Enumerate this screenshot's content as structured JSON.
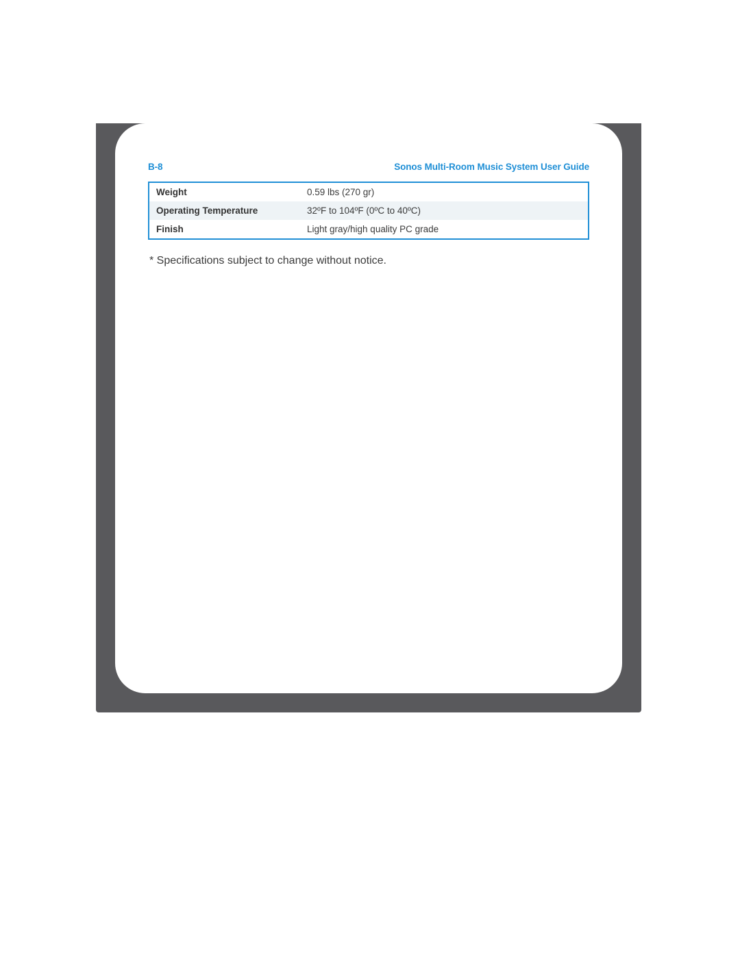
{
  "header": {
    "page_label": "B-8",
    "doc_title": "Sonos Multi-Room Music System User Guide"
  },
  "spec_table": {
    "rows": [
      {
        "label": "Weight",
        "value": "0.59 lbs (270 gr)"
      },
      {
        "label": "Operating Temperature",
        "value": "32ºF to 104ºF (0ºC to 40ºC)"
      },
      {
        "label": "Finish",
        "value": "Light gray/high quality PC grade"
      }
    ]
  },
  "footnote": "* Specifications subject to change without notice."
}
